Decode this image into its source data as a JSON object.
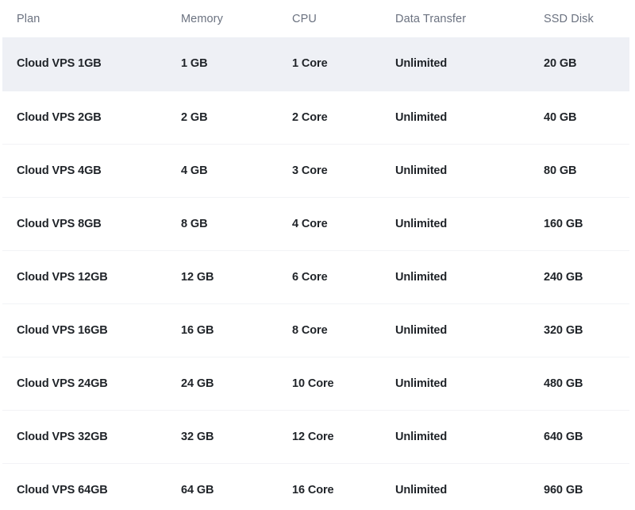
{
  "table": {
    "columns": [
      {
        "key": "plan",
        "label": "Plan"
      },
      {
        "key": "memory",
        "label": "Memory"
      },
      {
        "key": "cpu",
        "label": "CPU"
      },
      {
        "key": "transfer",
        "label": "Data Transfer"
      },
      {
        "key": "disk",
        "label": "SSD Disk"
      }
    ],
    "rows": [
      {
        "plan": "Cloud VPS 1GB",
        "memory": "1 GB",
        "cpu": "1 Core",
        "transfer": "Unlimited",
        "disk": "20 GB",
        "highlighted": true
      },
      {
        "plan": "Cloud VPS 2GB",
        "memory": "2 GB",
        "cpu": "2 Core",
        "transfer": "Unlimited",
        "disk": "40 GB",
        "highlighted": false
      },
      {
        "plan": "Cloud VPS 4GB",
        "memory": "4 GB",
        "cpu": "3 Core",
        "transfer": "Unlimited",
        "disk": "80 GB",
        "highlighted": false
      },
      {
        "plan": "Cloud VPS 8GB",
        "memory": "8 GB",
        "cpu": "4 Core",
        "transfer": "Unlimited",
        "disk": "160 GB",
        "highlighted": false
      },
      {
        "plan": "Cloud VPS 12GB",
        "memory": "12 GB",
        "cpu": "6 Core",
        "transfer": "Unlimited",
        "disk": "240 GB",
        "highlighted": false
      },
      {
        "plan": "Cloud VPS 16GB",
        "memory": "16 GB",
        "cpu": "8 Core",
        "transfer": "Unlimited",
        "disk": "320 GB",
        "highlighted": false
      },
      {
        "plan": "Cloud VPS 24GB",
        "memory": "24 GB",
        "cpu": "10 Core",
        "transfer": "Unlimited",
        "disk": "480 GB",
        "highlighted": false
      },
      {
        "plan": "Cloud VPS 32GB",
        "memory": "32 GB",
        "cpu": "12 Core",
        "transfer": "Unlimited",
        "disk": "640 GB",
        "highlighted": false
      },
      {
        "plan": "Cloud VPS 64GB",
        "memory": "64 GB",
        "cpu": "16 Core",
        "transfer": "Unlimited",
        "disk": "960 GB",
        "highlighted": false
      }
    ]
  },
  "colors": {
    "page_background": "#ffffff",
    "header_text": "#6b7280",
    "body_text": "#1f2328",
    "row_highlight": "#eef0f5",
    "row_separator": "#f2f3f6"
  }
}
